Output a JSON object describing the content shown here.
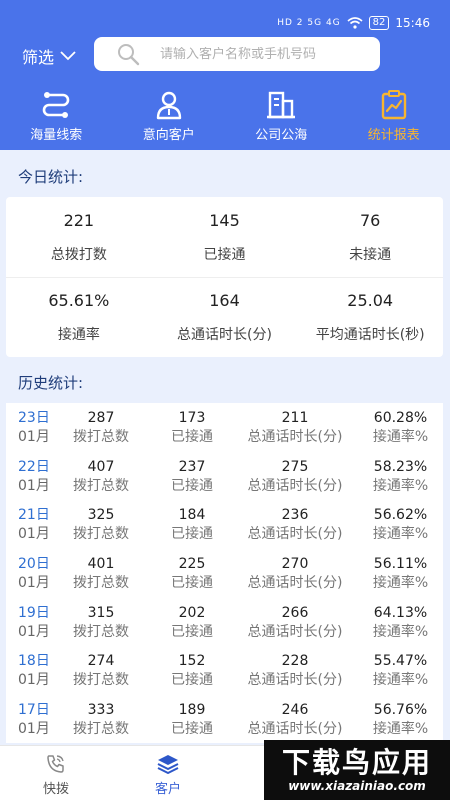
{
  "status_bar": {
    "signal": "HD 2 5G 4G",
    "battery": "82",
    "time": "15:46"
  },
  "header": {
    "filter_label": "筛选",
    "search_placeholder": "请输入客户名称或手机号码"
  },
  "nav": [
    {
      "label": "海量线索",
      "icon": "route-icon"
    },
    {
      "label": "意向客户",
      "icon": "user-icon"
    },
    {
      "label": "公司公海",
      "icon": "building-icon"
    },
    {
      "label": "统计报表",
      "icon": "report-icon",
      "active": true
    }
  ],
  "today": {
    "title": "今日统计:",
    "items": [
      {
        "value": "221",
        "label": "总拨打数"
      },
      {
        "value": "145",
        "label": "已接通"
      },
      {
        "value": "76",
        "label": "未接通"
      },
      {
        "value": "65.61%",
        "label": "接通率"
      },
      {
        "value": "164",
        "label": "总通话时长(分)"
      },
      {
        "value": "25.04",
        "label": "平均通话时长(秒)"
      }
    ]
  },
  "history": {
    "title": "历史统计:",
    "labels": {
      "dials": "拨打总数",
      "connected": "已接通",
      "duration": "总通话时长(分)",
      "rate": "接通率%"
    },
    "rows": [
      {
        "day": "23日",
        "month": "01月",
        "dials": "287",
        "connected": "173",
        "duration": "211",
        "rate": "60.28%"
      },
      {
        "day": "22日",
        "month": "01月",
        "dials": "407",
        "connected": "237",
        "duration": "275",
        "rate": "58.23%"
      },
      {
        "day": "21日",
        "month": "01月",
        "dials": "325",
        "connected": "184",
        "duration": "236",
        "rate": "56.62%"
      },
      {
        "day": "20日",
        "month": "01月",
        "dials": "401",
        "connected": "225",
        "duration": "270",
        "rate": "56.11%"
      },
      {
        "day": "19日",
        "month": "01月",
        "dials": "315",
        "connected": "202",
        "duration": "266",
        "rate": "64.13%"
      },
      {
        "day": "18日",
        "month": "01月",
        "dials": "274",
        "connected": "152",
        "duration": "228",
        "rate": "55.47%"
      },
      {
        "day": "17日",
        "month": "01月",
        "dials": "333",
        "connected": "189",
        "duration": "246",
        "rate": "56.76%"
      }
    ]
  },
  "bottom_tabs": [
    {
      "label": "快拨",
      "icon": "phone-icon"
    },
    {
      "label": "客户",
      "icon": "layers-icon",
      "active": true
    }
  ],
  "watermark": {
    "main": "下载鸟应用",
    "sub": "www.xiazainiao.com"
  },
  "colors": {
    "primary": "#4a73ea",
    "accent": "#f7b531",
    "page_bg": "#eaf0fd",
    "day_blue": "#2f6fd1"
  }
}
